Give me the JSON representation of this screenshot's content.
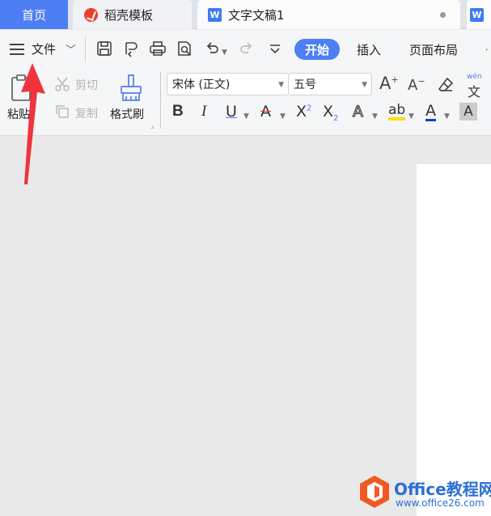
{
  "tabs": {
    "home": "首页",
    "template": "稻壳模板",
    "document": "文字文稿1"
  },
  "menu": {
    "file": "文件",
    "start": "开始",
    "insert": "插入",
    "layout": "页面布局"
  },
  "ribbon": {
    "paste": "粘贴",
    "cut": "剪切",
    "copy": "复制",
    "format_painter": "格式刷",
    "font_name": "宋体 (正文)",
    "font_size": "五号",
    "pinyin": "wén",
    "bold": "B",
    "italic": "I",
    "underline": "U",
    "strikethrough": "A",
    "superscript": "X",
    "superscript_mark": "2",
    "subscript": "X",
    "subscript_mark": "2",
    "text_effect": "A",
    "highlight": "ab",
    "font_color": "A",
    "char_shading": "A"
  },
  "watermark": {
    "title": "Office教程网",
    "url": "www.office26.com"
  },
  "colors": {
    "accent": "#4e7ef4",
    "arrow": "#f0333d",
    "watermark": "#2b6fd6",
    "watermark_logo": "#f05a22"
  },
  "icons": [
    "menu-icon",
    "save-icon",
    "print-icon",
    "print-preview-icon",
    "undo-icon",
    "redo-icon",
    "customize-icon",
    "paste-icon",
    "cut-icon",
    "copy-icon",
    "format-painter-icon",
    "grow-font-icon",
    "shrink-font-icon",
    "clear-format-icon",
    "pinyin-icon"
  ]
}
